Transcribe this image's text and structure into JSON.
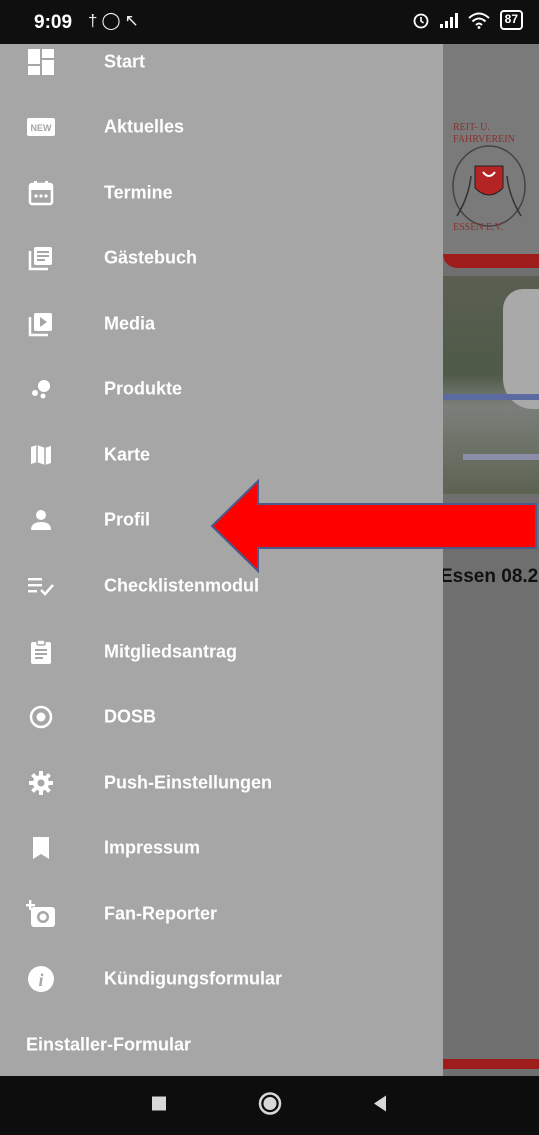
{
  "status_bar": {
    "time": "9:09",
    "battery": "87",
    "left_icons": [
      "bluetooth-icon",
      "alarm-icon",
      "signal-arrow-icon"
    ],
    "right_icons": [
      "alarm-clock-icon",
      "cell-signal-icon",
      "wifi-icon",
      "battery-icon"
    ]
  },
  "drawer": {
    "items": [
      {
        "label": "Start",
        "icon": "dashboard-icon"
      },
      {
        "label": "Aktuelles",
        "icon": "new-badge-icon"
      },
      {
        "label": "Termine",
        "icon": "calendar-icon"
      },
      {
        "label": "Gästebuch",
        "icon": "guestbook-icon"
      },
      {
        "label": "Media",
        "icon": "video-library-icon"
      },
      {
        "label": "Produkte",
        "icon": "products-icon"
      },
      {
        "label": "Karte",
        "icon": "map-icon"
      },
      {
        "label": "Profil",
        "icon": "person-icon"
      },
      {
        "label": "Checklistenmodul",
        "icon": "checklist-icon"
      },
      {
        "label": "Mitgliedsantrag",
        "icon": "clipboard-icon"
      },
      {
        "label": "DOSB",
        "icon": "radio-button-icon"
      },
      {
        "label": "Push-Einstellungen",
        "icon": "gear-icon"
      },
      {
        "label": "Impressum",
        "icon": "bookmark-icon"
      },
      {
        "label": "Fan-Reporter",
        "icon": "add-camera-icon"
      },
      {
        "label": "Kündigungsformular",
        "icon": "info-icon"
      }
    ],
    "footer_item": "Einstaller-Formular"
  },
  "background": {
    "logo_lines": [
      "REIT- U.",
      "FAHRVEREIN",
      "ESSEN E.V."
    ],
    "caption": "Essen 08.2"
  },
  "annotation": {
    "arrow_color": "#ff0000",
    "arrow_target": "Profil"
  },
  "nav_bar": {
    "buttons": [
      "recent-apps-icon",
      "home-icon",
      "back-icon"
    ]
  },
  "colors": {
    "drawer_bg": "#a6a6a6",
    "status_bar_bg": "#0f0f0f",
    "accent_red": "#9e1c1c"
  }
}
